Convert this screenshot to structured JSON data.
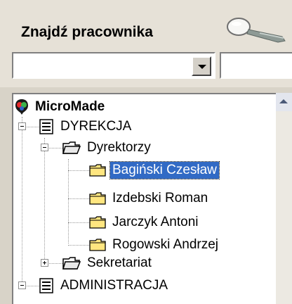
{
  "search": {
    "title": "Znajdź pracownika",
    "combo_value": "",
    "text_value": ""
  },
  "tree": {
    "root": {
      "label": "MicroMade",
      "icon": "micromade-logo-icon"
    },
    "nodes": [
      {
        "label": "DYREKCJA",
        "icon": "department-icon",
        "expanded": true
      },
      {
        "label": "Dyrektorzy",
        "icon": "open-folder-icon",
        "expanded": true
      },
      {
        "label": "Bagiński Czesław",
        "icon": "folder-icon",
        "selected": true
      },
      {
        "label": "Izdebski Roman",
        "icon": "folder-icon"
      },
      {
        "label": "Jarczyk Antoni",
        "icon": "folder-icon"
      },
      {
        "label": "Rogowski Andrzej",
        "icon": "folder-icon"
      },
      {
        "label": "Sekretariat",
        "icon": "open-folder-icon",
        "expanded": false
      },
      {
        "label": "ADMINISTRACJA",
        "icon": "department-icon",
        "expanded": true
      }
    ]
  },
  "colors": {
    "selection": "#316ac5",
    "folder": "#ffe680",
    "panel": "#e6e1d7"
  }
}
